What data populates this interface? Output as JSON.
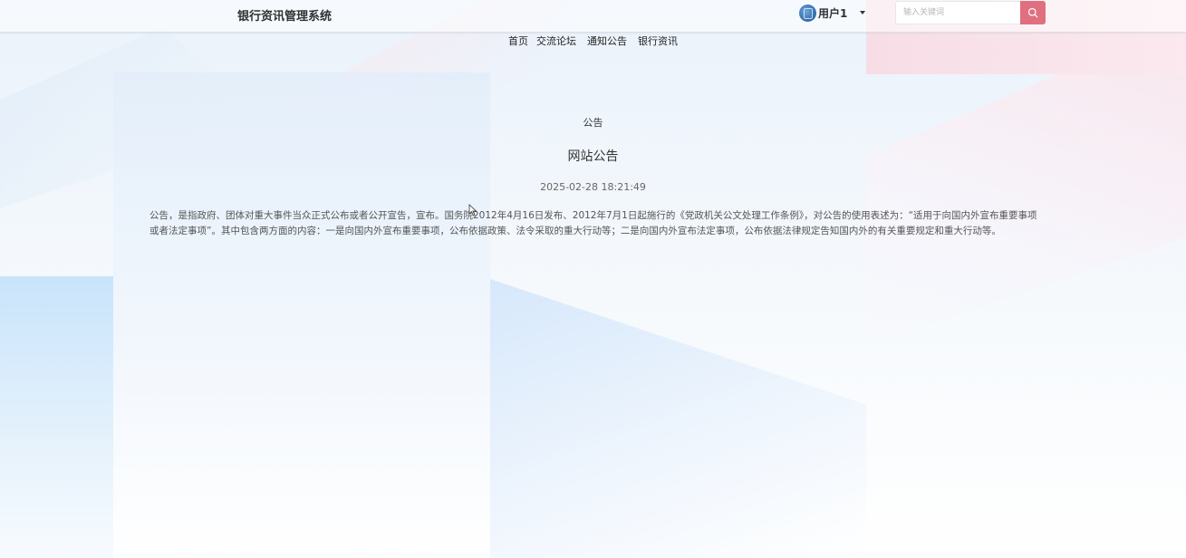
{
  "header": {
    "site_title": "银行资讯管理系统",
    "user_name": "用户1",
    "avatar_icon": "user-avatar-icon",
    "dropdown_icon": "caret-down-icon",
    "search": {
      "placeholder": "输入关键词",
      "value": "",
      "button_icon": "search-icon",
      "button_color": "#e0707f"
    }
  },
  "nav": {
    "items": [
      {
        "label": "首页"
      },
      {
        "label": "交流论坛"
      },
      {
        "label": "通知公告"
      },
      {
        "label": "银行资讯"
      }
    ]
  },
  "main": {
    "section_label": "公告",
    "title": "网站公告",
    "date": "2025-02-28 18:21:49",
    "body": "公告，是指政府、团体对重大事件当众正式公布或者公开宣告，宣布。国务院2012年4月16日发布、2012年7月1日起施行的《党政机关公文处理工作条例》，对公告的使用表述为：“适用于向国内外宣布重要事项或者法定事项”。其中包含两方面的内容：一是向国内外宣布重要事项，公布依据政策、法令采取的重大行动等；二是向国内外宣布法定事项，公布依据法律规定告知国内外的有关重要规定和重大行动等。"
  }
}
